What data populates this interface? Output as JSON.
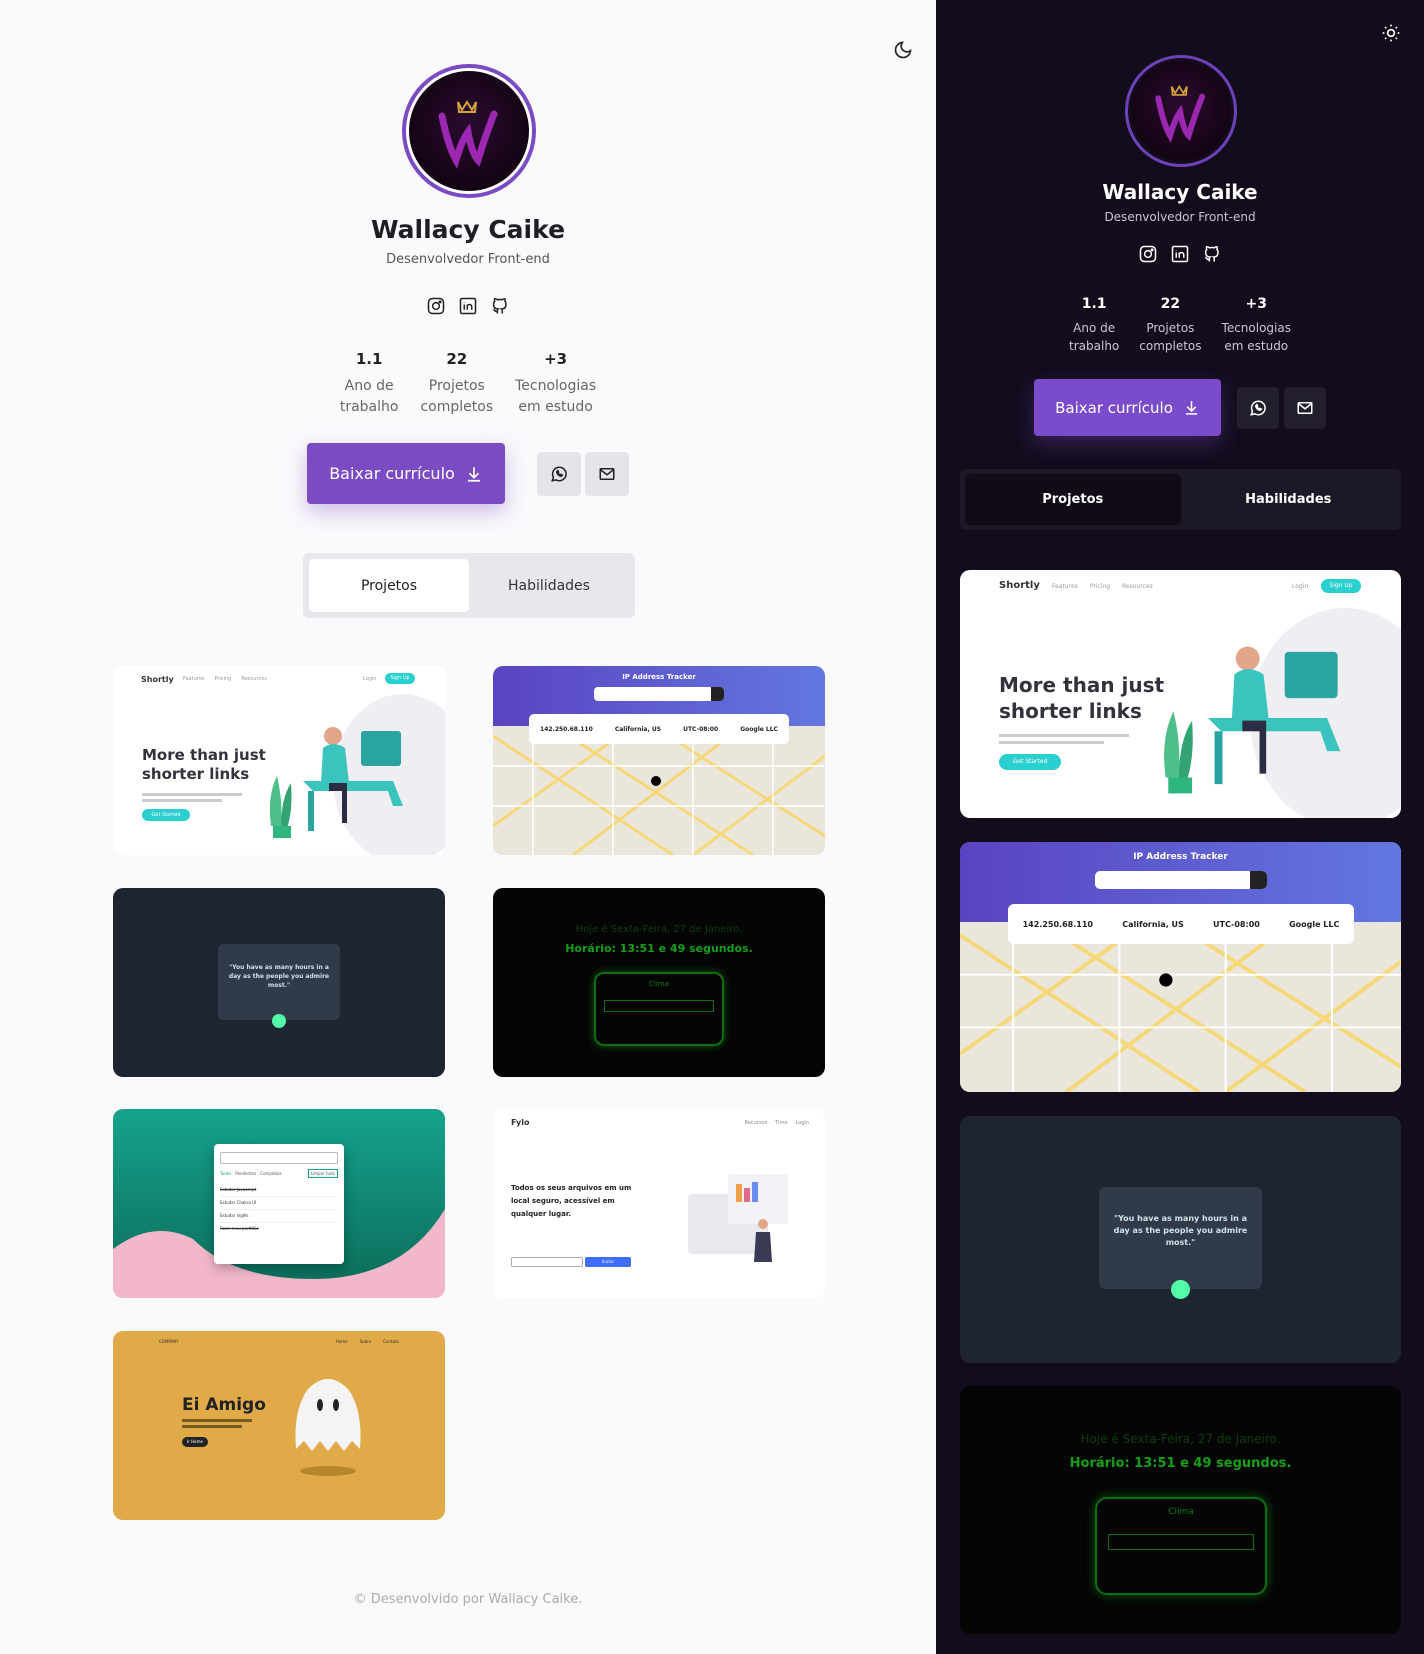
{
  "profile": {
    "name": "Wallacy Caike",
    "role": "Desenvolvedor Front-end"
  },
  "stats": [
    {
      "value": "1.1",
      "label": "Ano de\ntrabalho"
    },
    {
      "value": "22",
      "label": "Projetos\ncompletos"
    },
    {
      "value": "+3",
      "label": "Tecnologias\nem estudo"
    }
  ],
  "actions": {
    "download_label": "Baixar currículo"
  },
  "tabs": [
    {
      "label": "Projetos",
      "active": true
    },
    {
      "label": "Habilidades",
      "active": false
    }
  ],
  "projects": {
    "shortly": {
      "logo": "Shortly",
      "nav": [
        "Features",
        "Pricing",
        "Resources"
      ],
      "login": "Login",
      "signup": "Sign Up",
      "headline_1": "More than just",
      "headline_2": "shorter links",
      "cta": "Get Started"
    },
    "ip": {
      "title": "IP Address Tracker",
      "ip": "142.250.68.110",
      "location": "California, US",
      "timezone": "UTC-08:00",
      "isp": "Google LLC"
    },
    "quote": {
      "text": "\"You have as many hours in a day as the people you admire most.\""
    },
    "clock": {
      "date": "Hoje é Sexta-Feira, 27 de Janeiro.",
      "time": "Horário: 13:51 e 49 segundos.",
      "weather": "Clima"
    },
    "todo": {
      "filters": [
        "Todos",
        "Pendentes",
        "Completos"
      ],
      "clear": "Limpar tudo",
      "items": [
        "Estudar Javascript",
        "Estudar Chakra UI",
        "Estudar inglês",
        "Fazer meu portfólio"
      ]
    },
    "fylo": {
      "logo": "Fylo",
      "nav": [
        "Recursos",
        "Time",
        "Login"
      ],
      "headline": "Todos os seus arquivos em um local seguro, acessível em qualquer lugar.",
      "cta": "Iniciar"
    },
    "ghost": {
      "brand": "COMPANY",
      "nav": [
        "Home",
        "Sobre",
        "Contato"
      ],
      "title": "Ei Amigo",
      "cta": "Ir Home"
    }
  },
  "footer": "© Desenvolvido por Wallacy Caike.",
  "colors": {
    "accent": "#7b4bc4",
    "dark_bg": "#130c1d",
    "light_bg": "#faf9fc"
  },
  "icons": [
    "moon-icon",
    "sun-icon",
    "instagram-icon",
    "linkedin-icon",
    "github-icon",
    "download-icon",
    "whatsapp-icon",
    "mail-icon"
  ]
}
